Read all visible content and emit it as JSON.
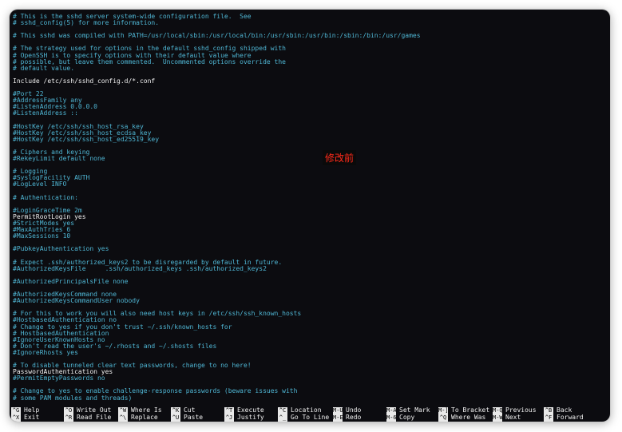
{
  "editor": {
    "lines": [
      {
        "text": "# This is the sshd server system-wide configuration file.  See",
        "style": "comment"
      },
      {
        "text": "# sshd_config(5) for more information.",
        "style": "comment"
      },
      {
        "text": "",
        "style": "normal"
      },
      {
        "text": "# This sshd was compiled with PATH=/usr/local/sbin:/usr/local/bin:/usr/sbin:/usr/bin:/sbin:/bin:/usr/games",
        "style": "comment"
      },
      {
        "text": "",
        "style": "normal"
      },
      {
        "text": "# The strategy used for options in the default sshd_config shipped with",
        "style": "comment"
      },
      {
        "text": "# OpenSSH is to specify options with their default value where",
        "style": "comment"
      },
      {
        "text": "# possible, but leave them commented.  Uncommented options override the",
        "style": "comment"
      },
      {
        "text": "# default value.",
        "style": "comment"
      },
      {
        "text": "",
        "style": "normal"
      },
      {
        "text": "Include /etc/ssh/sshd_config.d/*.conf",
        "style": "normal"
      },
      {
        "text": "",
        "style": "normal"
      },
      {
        "text": "#Port 22",
        "style": "comment"
      },
      {
        "text": "#AddressFamily any",
        "style": "comment"
      },
      {
        "text": "#ListenAddress 0.0.0.0",
        "style": "comment"
      },
      {
        "text": "#ListenAddress ::",
        "style": "comment"
      },
      {
        "text": "",
        "style": "normal"
      },
      {
        "text": "#HostKey /etc/ssh/ssh_host_rsa_key",
        "style": "comment"
      },
      {
        "text": "#HostKey /etc/ssh/ssh_host_ecdsa_key",
        "style": "comment"
      },
      {
        "text": "#HostKey /etc/ssh/ssh_host_ed25519_key",
        "style": "comment"
      },
      {
        "text": "",
        "style": "normal"
      },
      {
        "text": "# Ciphers and keying",
        "style": "comment"
      },
      {
        "text": "#RekeyLimit default none",
        "style": "comment"
      },
      {
        "text": "",
        "style": "normal"
      },
      {
        "text": "# Logging",
        "style": "comment"
      },
      {
        "text": "#SyslogFacility AUTH",
        "style": "comment"
      },
      {
        "text": "#LogLevel INFO",
        "style": "comment"
      },
      {
        "text": "",
        "style": "normal"
      },
      {
        "text": "# Authentication:",
        "style": "comment"
      },
      {
        "text": "",
        "style": "normal"
      },
      {
        "text": "#LoginGraceTime 2m",
        "style": "comment"
      },
      {
        "text": "PermitRootLogin yes",
        "style": "normal"
      },
      {
        "text": "#StrictModes yes",
        "style": "comment"
      },
      {
        "text": "#MaxAuthTries 6",
        "style": "comment"
      },
      {
        "text": "#MaxSessions 10",
        "style": "comment"
      },
      {
        "text": "",
        "style": "normal"
      },
      {
        "text": "#PubkeyAuthentication yes",
        "style": "comment"
      },
      {
        "text": "",
        "style": "normal"
      },
      {
        "text": "# Expect .ssh/authorized_keys2 to be disregarded by default in future.",
        "style": "comment"
      },
      {
        "text": "#AuthorizedKeysFile     .ssh/authorized_keys .ssh/authorized_keys2",
        "style": "comment"
      },
      {
        "text": "",
        "style": "normal"
      },
      {
        "text": "#AuthorizedPrincipalsFile none",
        "style": "comment"
      },
      {
        "text": "",
        "style": "normal"
      },
      {
        "text": "#AuthorizedKeysCommand none",
        "style": "comment"
      },
      {
        "text": "#AuthorizedKeysCommandUser nobody",
        "style": "comment"
      },
      {
        "text": "",
        "style": "normal"
      },
      {
        "text": "# For this to work you will also need host keys in /etc/ssh/ssh_known_hosts",
        "style": "comment"
      },
      {
        "text": "#HostbasedAuthentication no",
        "style": "comment"
      },
      {
        "text": "# Change to yes if you don't trust ~/.ssh/known_hosts for",
        "style": "comment"
      },
      {
        "text": "# HostbasedAuthentication",
        "style": "comment"
      },
      {
        "text": "#IgnoreUserKnownHosts no",
        "style": "comment"
      },
      {
        "text": "# Don't read the user's ~/.rhosts and ~/.shosts files",
        "style": "comment"
      },
      {
        "text": "#IgnoreRhosts yes",
        "style": "comment"
      },
      {
        "text": "",
        "style": "normal"
      },
      {
        "text": "# To disable tunneled clear text passwords, change to no here!",
        "style": "comment"
      },
      {
        "text": "PasswordAuthentication yes",
        "style": "normal"
      },
      {
        "text": "#PermitEmptyPasswords no",
        "style": "comment"
      },
      {
        "text": "",
        "style": "normal"
      },
      {
        "text": "# Change to yes to enable challenge-response passwords (beware issues with",
        "style": "comment"
      },
      {
        "text": "# some PAM modules and threads)",
        "style": "comment"
      }
    ]
  },
  "overlay_label": "修改前",
  "shortcuts": [
    {
      "key1": "^G",
      "label1": "Help",
      "key2": "^X",
      "label2": "Exit"
    },
    {
      "key1": "^O",
      "label1": "Write Out",
      "key2": "^R",
      "label2": "Read File"
    },
    {
      "key1": "^W",
      "label1": "Where Is",
      "key2": "^\\",
      "label2": "Replace"
    },
    {
      "key1": "^K",
      "label1": "Cut",
      "key2": "^U",
      "label2": "Paste"
    },
    {
      "key1": "^T",
      "label1": "Execute",
      "key2": "^J",
      "label2": "Justify"
    },
    {
      "key1": "^C",
      "label1": "Location",
      "key2": "^_",
      "label2": "Go To Line"
    },
    {
      "key1": "M-U",
      "label1": "Undo",
      "key2": "M-E",
      "label2": "Redo"
    },
    {
      "key1": "M-A",
      "label1": "Set Mark",
      "key2": "M-6",
      "label2": "Copy"
    },
    {
      "key1": "M-]",
      "label1": "To Bracket",
      "key2": "^Q",
      "label2": "Where Was"
    },
    {
      "key1": "M-Q",
      "label1": "Previous",
      "key2": "M-W",
      "label2": "Next"
    },
    {
      "key1": "^B",
      "label1": "Back",
      "key2": "^F",
      "label2": "Forward"
    }
  ],
  "colors": {
    "background": "#0c0c10",
    "comment": "#4fb6d4",
    "text": "#f0f0f0",
    "overlay_text": "#ff2a1a"
  }
}
